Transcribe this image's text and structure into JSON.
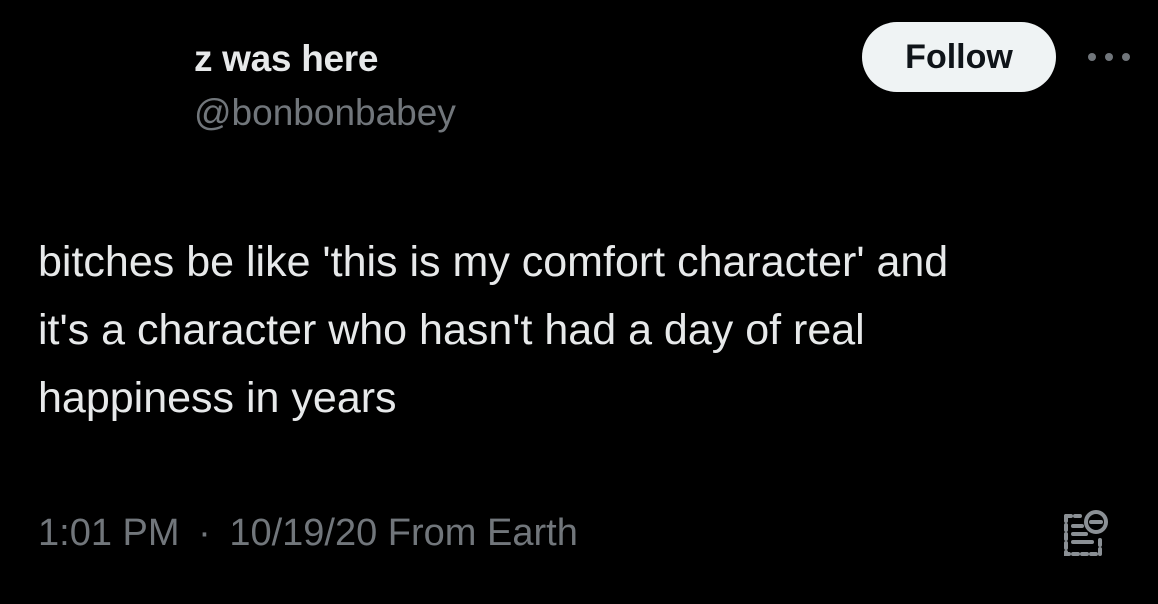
{
  "user": {
    "display_name": "z was here",
    "handle": "@bonbonbabey"
  },
  "actions": {
    "follow_label": "Follow",
    "more_icon": "more-horizontal-icon"
  },
  "tweet": {
    "lines": [
      "bitches be like 'this is my comfort character' and",
      "it's a character who hasn't had a day of real",
      "happiness in years"
    ]
  },
  "meta": {
    "time": "1:01 PM",
    "separator": "·",
    "date": "10/19/20",
    "source": "From Earth",
    "icon": "view-analytics-icon"
  },
  "colors": {
    "background": "#000000",
    "text_primary": "#e7e9ea",
    "text_secondary": "#71767b",
    "button_bg": "#eff3f4",
    "button_text": "#0f1419"
  }
}
